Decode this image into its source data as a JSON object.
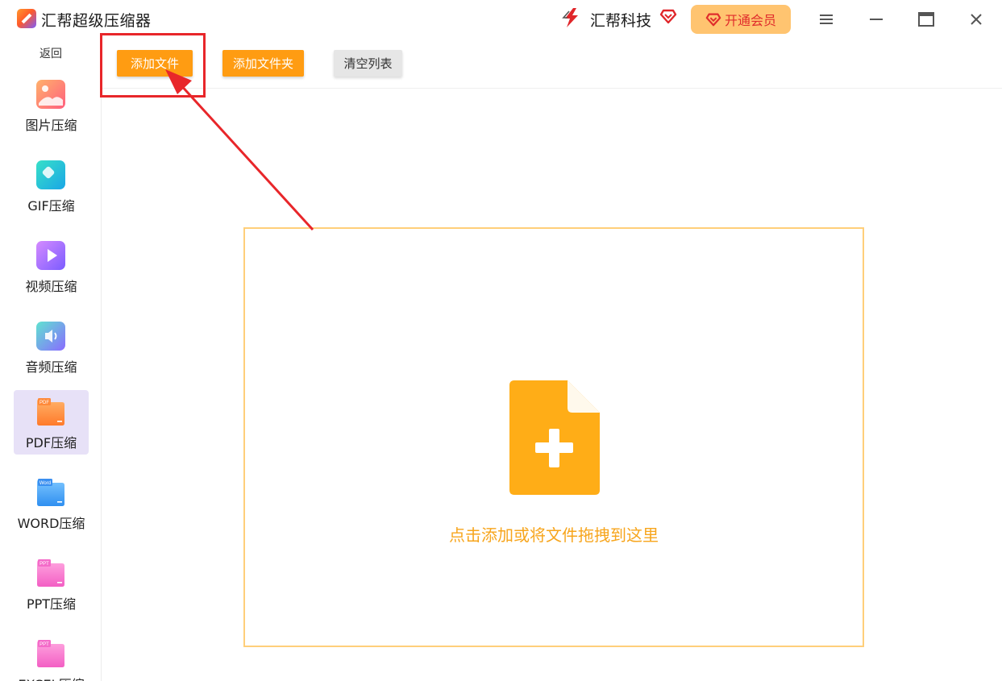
{
  "window": {
    "app_title": "汇帮超级压缩器",
    "brand_name": "汇帮科技",
    "vip_label": "开通会员"
  },
  "sidebar": {
    "back_label": "返回",
    "items": [
      {
        "label": "图片压缩",
        "icon": "image-icon",
        "active": false
      },
      {
        "label": "GIF压缩",
        "icon": "gif-icon",
        "active": false
      },
      {
        "label": "视频压缩",
        "icon": "video-icon",
        "active": false
      },
      {
        "label": "音频压缩",
        "icon": "audio-icon",
        "active": false
      },
      {
        "label": "PDF压缩",
        "icon": "pdf-icon",
        "badge": "PDF",
        "active": true
      },
      {
        "label": "WORD压缩",
        "icon": "word-icon",
        "badge": "Word",
        "active": false
      },
      {
        "label": "PPT压缩",
        "icon": "ppt-icon",
        "badge": "PPT",
        "active": false
      },
      {
        "label": "EXCEL压缩",
        "icon": "excel-icon",
        "badge": "PPT",
        "active": false
      }
    ]
  },
  "toolbar": {
    "add_file_label": "添加文件",
    "add_folder_label": "添加文件夹",
    "clear_list_label": "清空列表"
  },
  "dropzone": {
    "hint_text": "点击添加或将文件拖拽到这里"
  },
  "colors": {
    "accent_orange": "#ff9c12",
    "drop_border": "#ffcf7a",
    "drop_text": "#f7a51c",
    "annotation_red": "#e8262a",
    "active_sidebar_bg": "#e7e1f7",
    "vip_bg": "#ffc470"
  }
}
